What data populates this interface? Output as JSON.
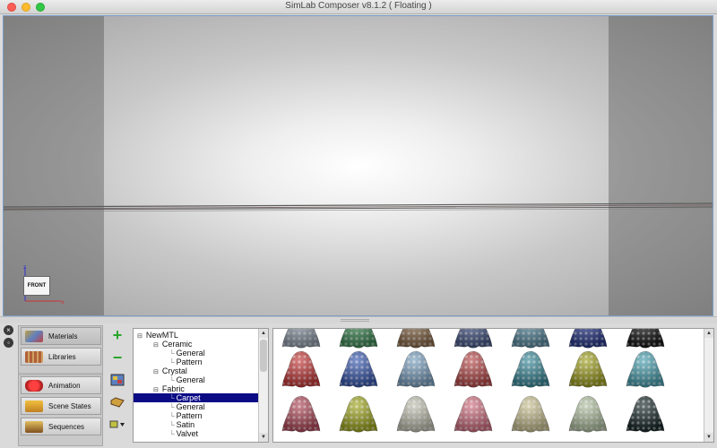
{
  "window": {
    "title": "SimLab Composer v8.1.2 ( Floating )"
  },
  "viewport": {
    "view_label": "FRONT",
    "axis_up": "z",
    "axis_right": "x"
  },
  "panel_nav": {
    "materials": "Materials",
    "libraries": "Libraries",
    "animation": "Animation",
    "scene_states": "Scene States",
    "sequences": "Sequences"
  },
  "tree": {
    "root": "NewMTL",
    "ceramic": "Ceramic",
    "ceramic_general": "General",
    "ceramic_pattern": "Pattern",
    "crystal": "Crystal",
    "crystal_general": "General",
    "fabric": "Fabric",
    "fabric_carpet": "Carpet",
    "fabric_general": "General",
    "fabric_pattern": "Pattern",
    "fabric_satin": "Satin",
    "fabric_valvet": "Valvet"
  },
  "colors": {
    "selection": "#0b0b86",
    "viewport_border": "#7a9cc4",
    "add_icon": "#2aa52a",
    "remove_icon": "#2aa52a"
  },
  "swatches": [
    [
      "#8f9aa8",
      "#3f8a56",
      "#8a6a4a",
      "#4a5a8a",
      "#5a8aa0",
      "#2a3a8a",
      "#1a1a1a"
    ],
    [
      "#c63a3a",
      "#3a5ab0",
      "#7aa0c0",
      "#b84a4a",
      "#3a8a9a",
      "#a0a020",
      "#4aa0b0"
    ],
    [
      "#b04a5a",
      "#a0a820",
      "#c0c0b0",
      "#d07080",
      "#c8c090",
      "#b0c0a0",
      "#1a2a2a"
    ]
  ]
}
